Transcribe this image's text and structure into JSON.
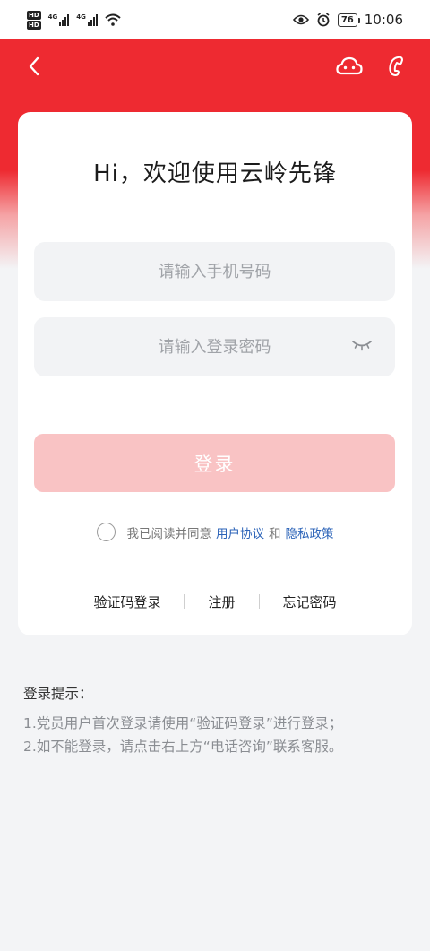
{
  "status_bar": {
    "hd1": "HD",
    "hd2": "HD",
    "net1": "4G",
    "net2": "4G",
    "battery": "76",
    "time": "10:06"
  },
  "header": {
    "back_icon": "chevron-left-icon",
    "service_icon": "cloud-service-icon",
    "phone_icon": "phone-icon"
  },
  "card": {
    "welcome": "Hi，欢迎使用云岭先锋",
    "phone_placeholder": "请输入手机号码",
    "password_placeholder": "请输入登录密码",
    "login_label": "登录",
    "agree_text": "我已阅读并同意",
    "user_agreement": "用户协议",
    "and": "和",
    "privacy_policy": "隐私政策",
    "links": {
      "sms_login": "验证码登录",
      "register": "注册",
      "forgot": "忘记密码"
    }
  },
  "tips": {
    "title": "登录提示：",
    "line1": "1.党员用户首次登录请使用“验证码登录”进行登录；",
    "line2": "2.如不能登录，请点击右上方“电话咨询”联系客服。"
  },
  "colors": {
    "brand_red": "#ee2a31",
    "login_button_disabled": "#f9c3c4",
    "link_blue": "#2b63b8"
  }
}
